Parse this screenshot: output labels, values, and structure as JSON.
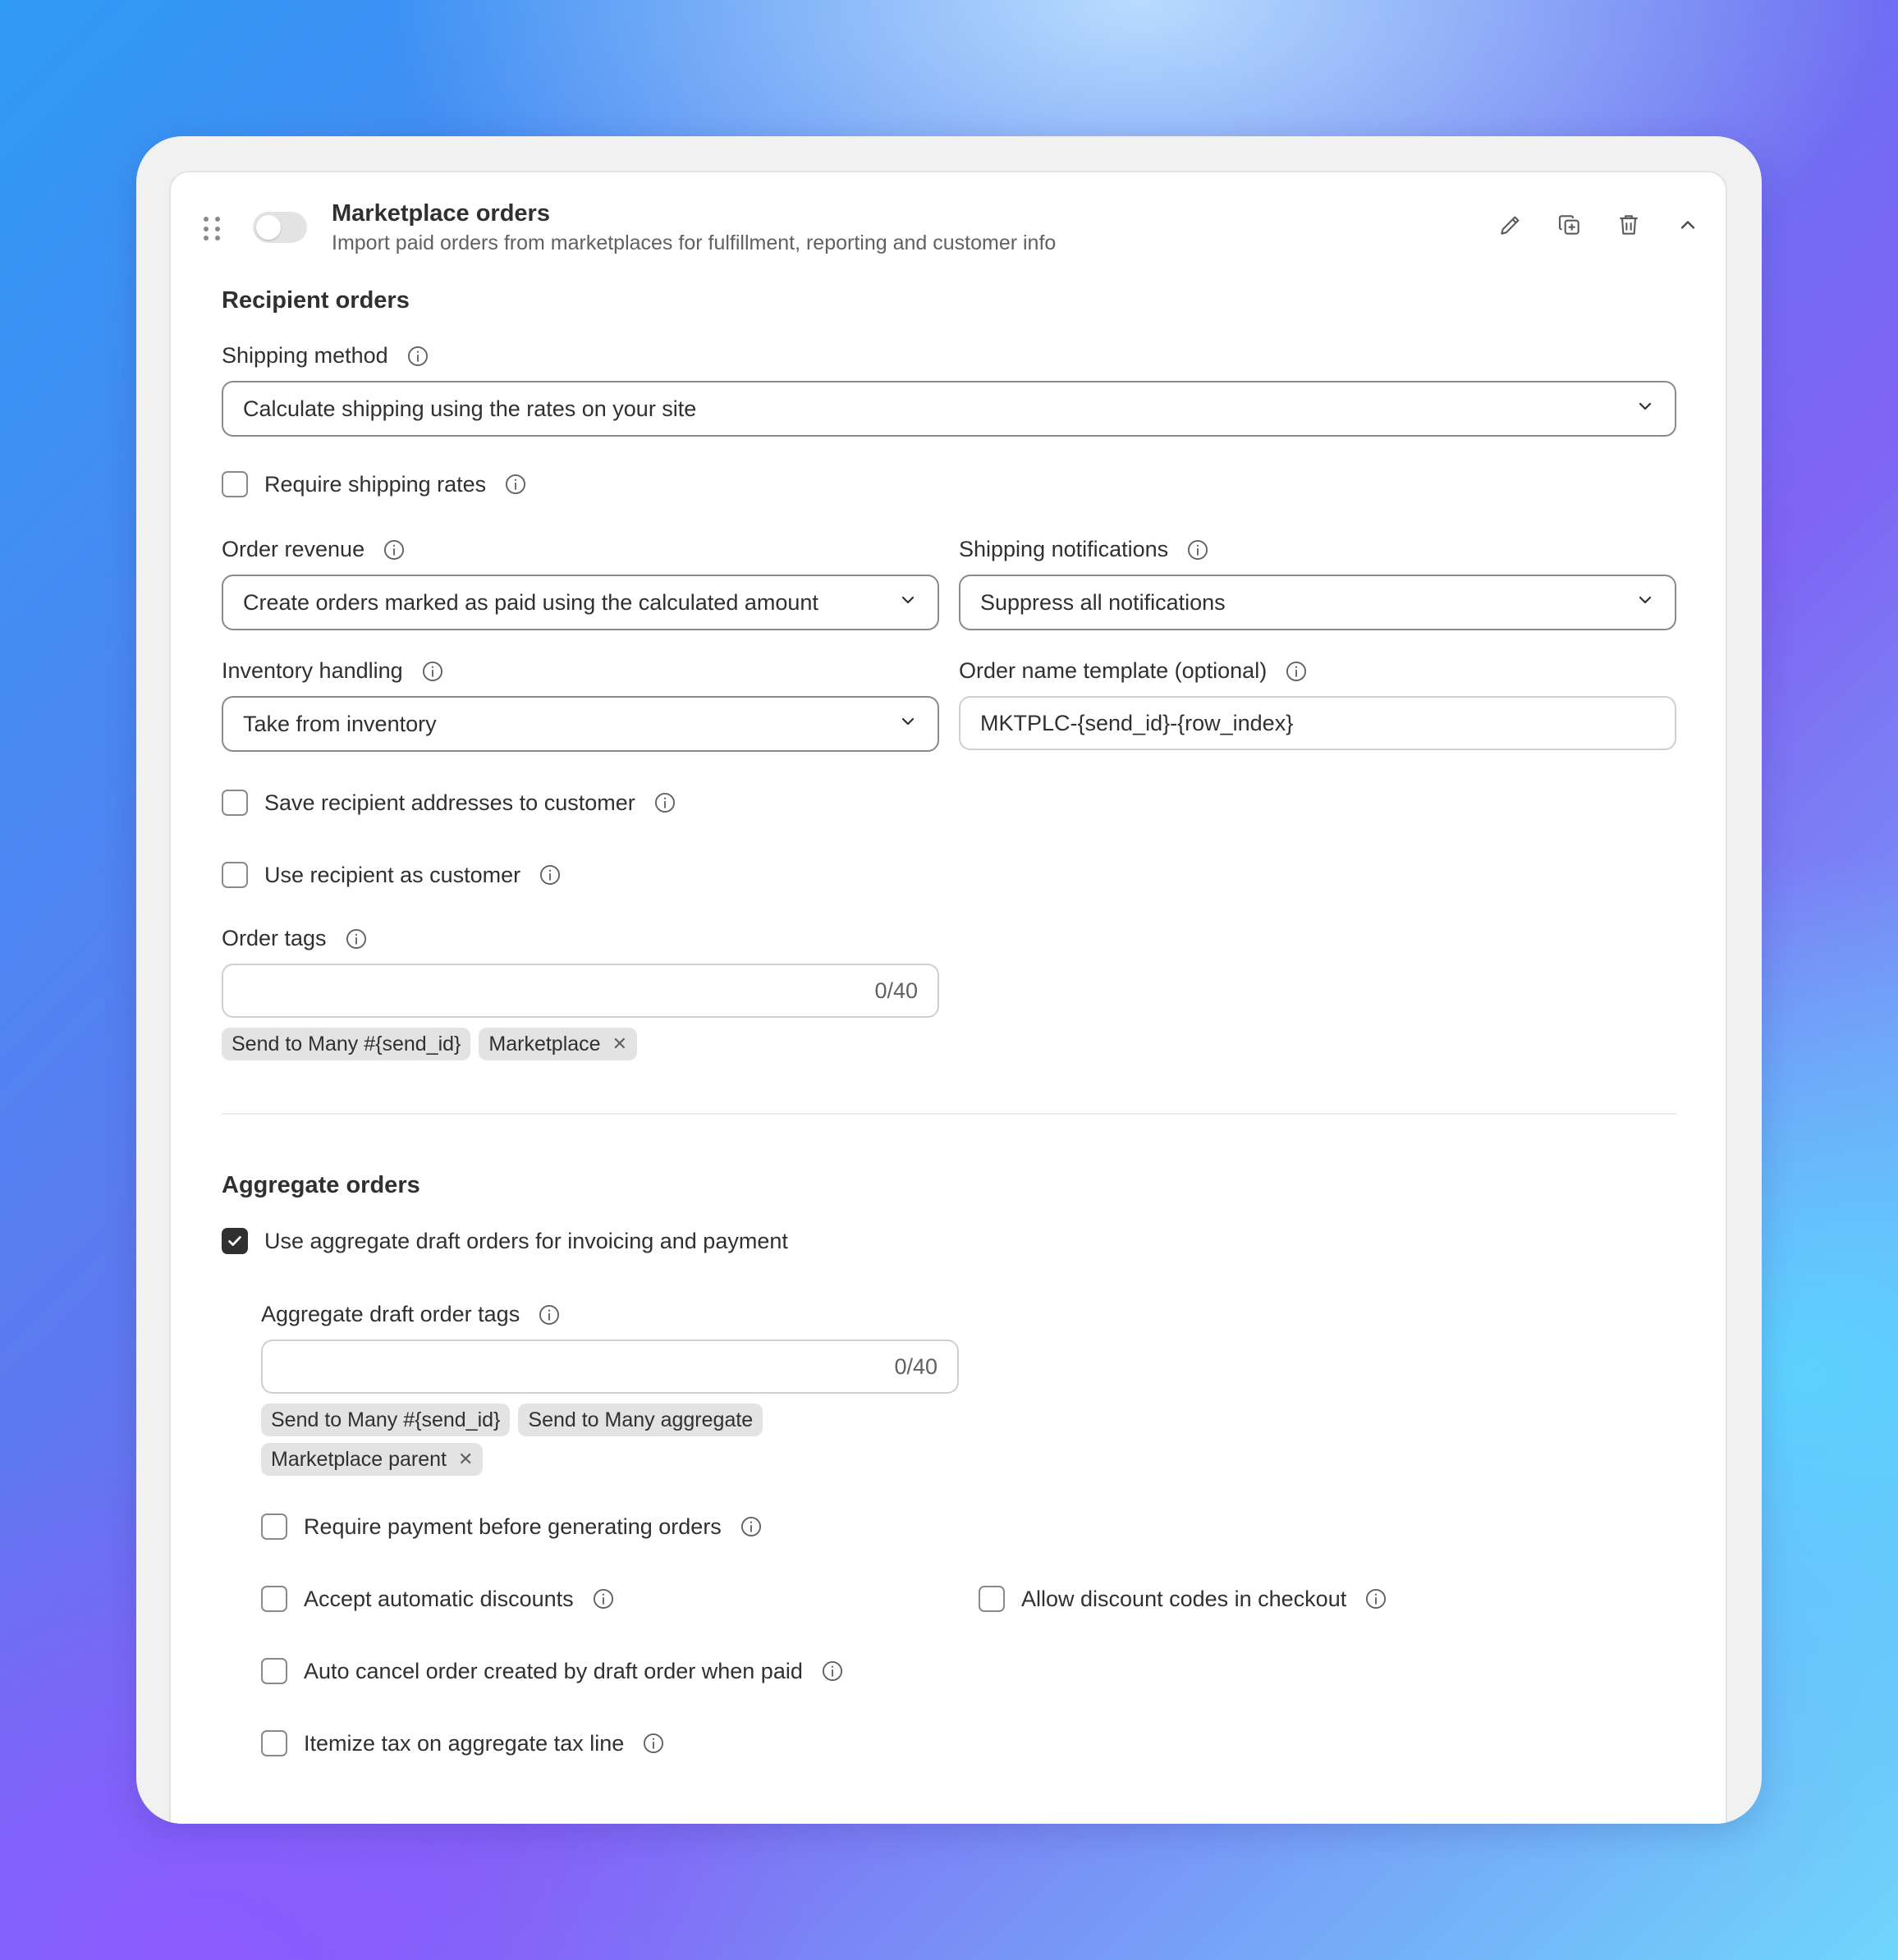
{
  "header": {
    "title": "Marketplace orders",
    "subtitle": "Import paid orders from marketplaces for fulfillment, reporting and customer info",
    "enabled": false
  },
  "recipient": {
    "section_title": "Recipient orders",
    "shipping_method": {
      "label": "Shipping method",
      "value": "Calculate shipping using the rates on your site"
    },
    "require_shipping_rates": {
      "label": "Require shipping rates",
      "checked": false
    },
    "order_revenue": {
      "label": "Order revenue",
      "value": "Create orders marked as paid using the calculated amount"
    },
    "shipping_notifications": {
      "label": "Shipping notifications",
      "value": "Suppress all notifications"
    },
    "inventory_handling": {
      "label": "Inventory handling",
      "value": "Take from inventory"
    },
    "order_name_template": {
      "label": "Order name template (optional)",
      "value": "MKTPLC-{send_id}-{row_index}"
    },
    "save_addresses": {
      "label": "Save recipient addresses to customer",
      "checked": false
    },
    "use_recipient": {
      "label": "Use recipient as customer",
      "checked": false
    },
    "order_tags": {
      "label": "Order tags",
      "counter": "0/40",
      "tags": [
        "Send to Many #{send_id}",
        "Marketplace"
      ],
      "remove_symbol": "✕"
    }
  },
  "aggregate": {
    "section_title": "Aggregate orders",
    "use_aggregate": {
      "label": "Use aggregate draft orders for invoicing and payment",
      "checked": true
    },
    "draft_tags": {
      "label": "Aggregate draft order tags",
      "counter": "0/40",
      "tags": [
        "Send to Many #{send_id}",
        "Send to Many aggregate",
        "Marketplace parent"
      ],
      "remove_symbol": "✕"
    },
    "require_payment": {
      "label": "Require payment before generating orders",
      "checked": false
    },
    "accept_discounts": {
      "label": "Accept automatic discounts",
      "checked": false
    },
    "allow_codes": {
      "label": "Allow discount codes in checkout",
      "checked": false
    },
    "auto_cancel": {
      "label": "Auto cancel order created by draft order when paid",
      "checked": false
    },
    "itemize_tax": {
      "label": "Itemize tax on aggregate tax line",
      "checked": false
    }
  },
  "icons": [
    "drag-handle-icon",
    "edit-icon",
    "duplicate-icon",
    "delete-icon",
    "chevron-up-icon",
    "info-icon",
    "chevron-down-icon",
    "checkmark-icon",
    "close-icon"
  ],
  "colors": {
    "text": "#303030",
    "subtext": "#616161",
    "border": "#8a8a8a",
    "tag_bg": "#e3e3e3",
    "checked": "#303030"
  }
}
